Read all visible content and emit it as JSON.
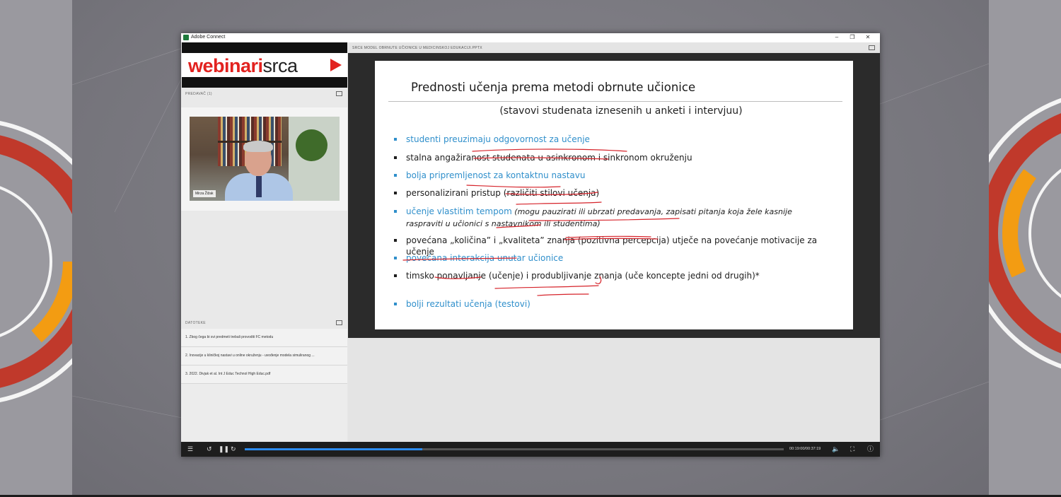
{
  "window": {
    "title": "Adobe Connect",
    "buttons": [
      "–",
      "❐",
      "✕"
    ]
  },
  "banner": {
    "text_red": "webinari",
    "text_dark": "srca"
  },
  "presenter_pod": {
    "label": "PREDAVAČ (1)",
    "name_tag": "Mirza Žižak"
  },
  "files_pod": {
    "label": "DATOTEKE",
    "items": [
      "1. Zbog čega bi svi predmeti trebali provoditi FC metodu",
      "2. Inovacije u kliničkoj nastavi u online okruženju - uvođenje modela simuliranog ...",
      "3. 2022. Divjak et al. Int J Educ Technol High Educ.pdf"
    ]
  },
  "share_pod": {
    "label": "SRCE MODEL OBRNUTE UČIONICE U MEDICINSKOJ EDUKACIJI.PPTX"
  },
  "slide": {
    "title": "Prednosti učenja prema metodi obrnute učionice",
    "subtitle": "(stavovi studenata iznesenih u anketi i intervjuu)",
    "bullets": [
      {
        "text": "studenti preuzimaju odgovornost za učenje",
        "italic": "",
        "style": "blue"
      },
      {
        "text": "stalna angažiranost studenata u asinkronom i sinkronom okruženju",
        "italic": "",
        "style": "dark"
      },
      {
        "text": "bolja pripremljenost za kontaktnu nastavu",
        "italic": "",
        "style": "blue"
      },
      {
        "text": "personalizirani pristup (različiti stilovi učenja)",
        "italic": "",
        "style": "dark"
      },
      {
        "text": "učenje vlastitim tempom",
        "italic": " (mogu pauzirati ili ubrzati predavanja, zapisati pitanja koja žele kasnije raspraviti u učionici s nastavnikom ili studentima)",
        "style": "blue"
      },
      {
        "text": "povećana „količina” i „kvaliteta” znanja (pozitivna percepcija) utječe na povećanje motivacije za učenje",
        "italic": "",
        "style": "dark"
      },
      {
        "text": "povećana interakcija unutar učionice",
        "italic": "",
        "style": "blue"
      },
      {
        "text": "timsko ponavljanje (učenje) i produbljivanje znanja  (uče koncepte jedni od drugih)*",
        "italic": "",
        "style": "dark"
      },
      {
        "text": "bolji rezultati učenja (testovi)",
        "italic": "",
        "style": "blue"
      }
    ]
  },
  "playback": {
    "time": "00:19:00/00:37:19",
    "progress": 0.33,
    "progress_color": "#2d8cf0",
    "icons": [
      "menu-icon",
      "rewind-icon",
      "pause-icon",
      "forward-icon",
      "volume-icon",
      "fullscreen-icon",
      "info-icon"
    ]
  },
  "colors": {
    "brand_red": "#e2221f",
    "slide_blue": "#2f8fcb",
    "ink_red": "#d6232a"
  }
}
